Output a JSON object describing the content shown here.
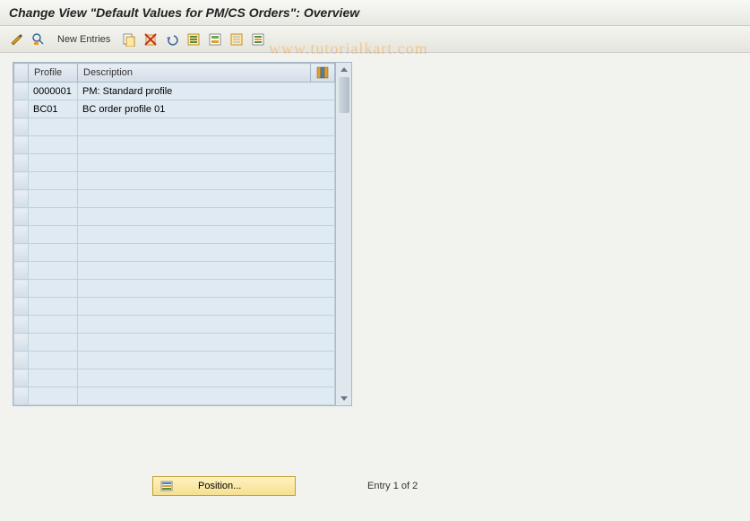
{
  "title": "Change View \"Default Values for PM/CS Orders\": Overview",
  "toolbar": {
    "new_entries": "New Entries"
  },
  "table": {
    "headers": {
      "profile": "Profile",
      "description": "Description"
    },
    "rows": [
      {
        "profile": "0000001",
        "description": "PM: Standard profile"
      },
      {
        "profile": "BC01",
        "description": "BC order profile 01"
      },
      {
        "profile": "",
        "description": ""
      },
      {
        "profile": "",
        "description": ""
      },
      {
        "profile": "",
        "description": ""
      },
      {
        "profile": "",
        "description": ""
      },
      {
        "profile": "",
        "description": ""
      },
      {
        "profile": "",
        "description": ""
      },
      {
        "profile": "",
        "description": ""
      },
      {
        "profile": "",
        "description": ""
      },
      {
        "profile": "",
        "description": ""
      },
      {
        "profile": "",
        "description": ""
      },
      {
        "profile": "",
        "description": ""
      },
      {
        "profile": "",
        "description": ""
      },
      {
        "profile": "",
        "description": ""
      },
      {
        "profile": "",
        "description": ""
      },
      {
        "profile": "",
        "description": ""
      },
      {
        "profile": "",
        "description": ""
      }
    ]
  },
  "footer": {
    "position_label": "Position...",
    "entry_text": "Entry 1 of 2"
  },
  "watermark": "www.tutorialkart.com"
}
